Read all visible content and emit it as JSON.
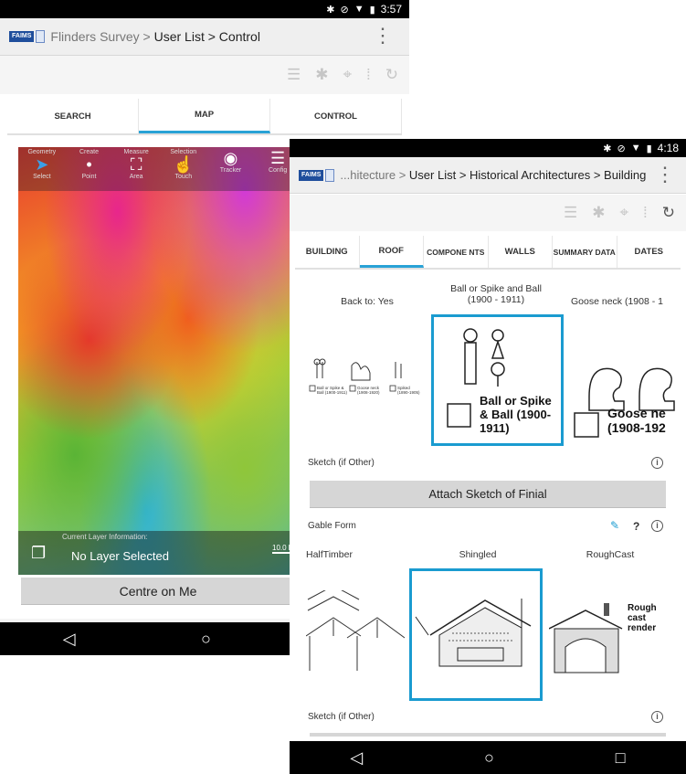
{
  "back_phone": {
    "status_time": "3:57",
    "breadcrumb_prefix": "Flinders Survey >",
    "breadcrumb_rest": "User List > Control",
    "tabs": [
      "SEARCH",
      "MAP",
      "CONTROL"
    ],
    "active_tab": "MAP",
    "map_tools": [
      {
        "top": "Geometry",
        "bottom": "Select",
        "icon": "arrow-icon"
      },
      {
        "top": "Create",
        "bottom": "Point",
        "icon": "point-icon"
      },
      {
        "top": "Measure",
        "bottom": "Area",
        "icon": "area-icon"
      },
      {
        "top": "Selection",
        "bottom": "Touch",
        "icon": "hand-icon"
      },
      {
        "top": "",
        "bottom": "Tracker",
        "icon": "tracker-icon"
      },
      {
        "top": "",
        "bottom": "Config",
        "icon": "sliders-icon"
      }
    ],
    "layer_info_label": "Current Layer Information:",
    "layer_value": "No Layer Selected",
    "scale_label": "10.0 km",
    "centre_button": "Centre on Me"
  },
  "front_phone": {
    "status_time": "4:18",
    "breadcrumb_prefix": "...hitecture >",
    "breadcrumb_rest": "User List > Historical Architectures > Building",
    "tabs": [
      "BUILDING",
      "ROOF",
      "COMPONE NTS",
      "WALLS",
      "SUMMARY DATA",
      "DATES"
    ],
    "active_tab": "ROOF",
    "finial_options": [
      {
        "caption": "Back to: Yes",
        "mini_labels": [
          "Ball or Spike & Ball (1900-1911)",
          "Goose neck (1908-1920)",
          "Spiked (1890-1905)"
        ]
      },
      {
        "caption": "Ball or Spike and Ball (1900 - 1911)",
        "image_text": "Ball or Spike & Ball (1900-1911)"
      },
      {
        "caption": "Goose neck (1908 - 1",
        "image_text": "Goose ne (1908-192"
      }
    ],
    "sketch_label_1": "Sketch (if Other)",
    "attach_button": "Attach Sketch of Finial",
    "gable_label": "Gable Form",
    "gable_question": "?",
    "gable_options": [
      {
        "caption": "HalfTimber"
      },
      {
        "caption": "Shingled"
      },
      {
        "caption": "RoughCast",
        "image_text": "Rough cast render"
      }
    ],
    "sketch_label_2": "Sketch (if Other)",
    "info_glyph": "i",
    "accent_color": "#1a9bd0"
  }
}
